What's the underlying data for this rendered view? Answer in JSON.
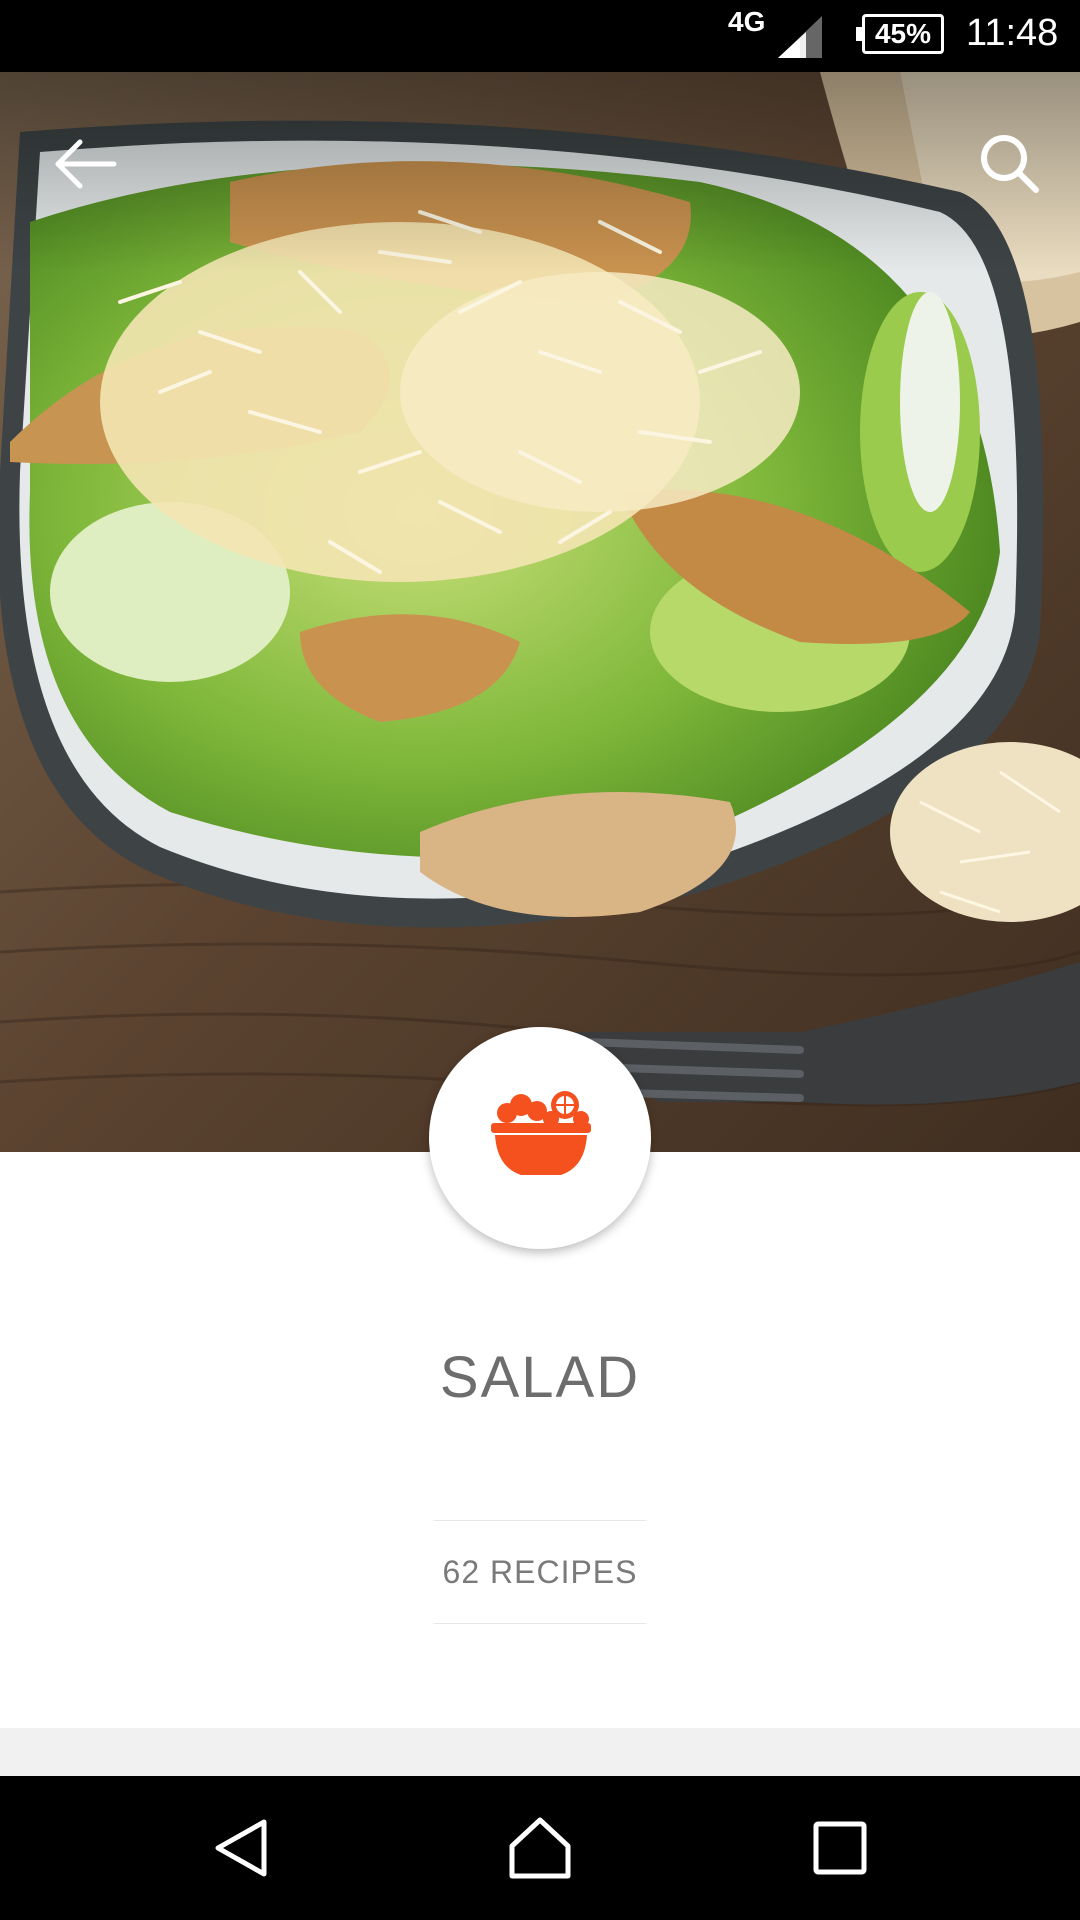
{
  "status_bar": {
    "network": "4G",
    "battery": "45%",
    "time": "11:48"
  },
  "hero": {
    "image": "caesar-salad-photo",
    "back_icon": "arrow-left-icon",
    "search_icon": "search-icon"
  },
  "category": {
    "icon": "salad-bowl-icon",
    "icon_color": "#f4511e",
    "title": "SALAD",
    "count": "62 RECIPES"
  },
  "nav_bar": {
    "back": "nav-back-icon",
    "home": "nav-home-icon",
    "recent": "nav-recents-icon"
  }
}
